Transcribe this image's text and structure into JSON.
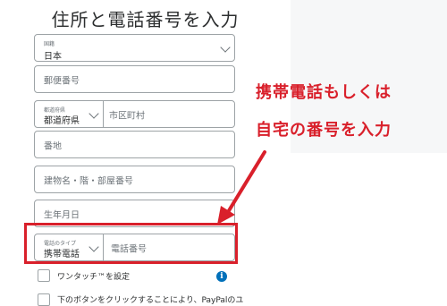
{
  "page": {
    "title": "住所と電話番号を入力"
  },
  "form": {
    "country": {
      "label": "国籍",
      "value": "日本"
    },
    "postal_code": {
      "placeholder": "郵便番号"
    },
    "prefecture": {
      "label": "都道府県",
      "value": "都道府県"
    },
    "city": {
      "placeholder": "市区町村"
    },
    "street": {
      "placeholder": "番地"
    },
    "building": {
      "placeholder": "建物名・階・部屋番号"
    },
    "birthdate": {
      "placeholder": "生年月日"
    },
    "phone_type": {
      "label": "電話のタイプ",
      "value": "携帯電話"
    },
    "phone_number": {
      "placeholder": "電話番号"
    }
  },
  "checkboxes": {
    "one_touch": "ワンタッチ™を設定",
    "consent": "下のボタンをクリックすることにより、PayPalのユ"
  },
  "info_icon": "info-icon",
  "annotation": {
    "line1": "携帯電話もしくは",
    "line2": "自宅の番号を入力",
    "color": "#d9202b"
  },
  "colors": {
    "accent_red": "#d9202b",
    "paypal_blue": "#0070ba",
    "field_border": "#9da3a6"
  }
}
